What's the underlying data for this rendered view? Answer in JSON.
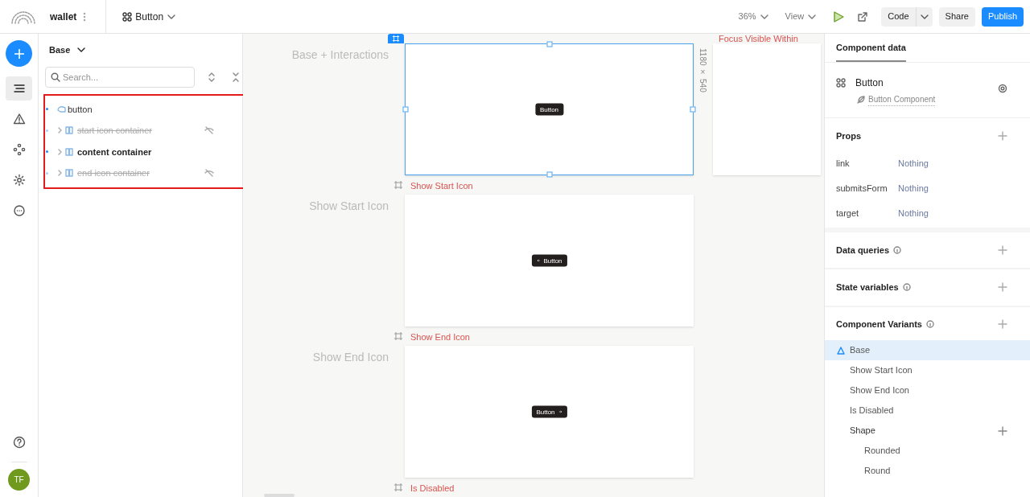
{
  "topbar": {
    "project": "wallet",
    "component": "Button",
    "zoom": "36%",
    "view": "View",
    "code": "Code",
    "share": "Share",
    "publish": "Publish"
  },
  "rail": {
    "items": [
      {
        "kind": "outline",
        "selected": true
      },
      {
        "kind": "warning",
        "selected": false
      },
      {
        "kind": "components",
        "selected": false
      },
      {
        "kind": "settings",
        "selected": false
      },
      {
        "kind": "more",
        "selected": false
      }
    ],
    "avatar": "TF"
  },
  "left_panel": {
    "variant": "Base",
    "search": {
      "placeholder": "Search..."
    },
    "tree": [
      {
        "label": "button",
        "kind": "component",
        "hidden": false,
        "children": [
          {
            "label": "start icon container",
            "kind": "container",
            "hidden": true
          },
          {
            "label": "content container",
            "kind": "container",
            "hidden": false
          },
          {
            "label": "end icon container",
            "kind": "container",
            "hidden": true
          }
        ]
      }
    ]
  },
  "canvas": {
    "rows": [
      {
        "label": "Base + Interactions",
        "frame_title": "",
        "selected": true,
        "button": "Button",
        "kind": "plain"
      },
      {
        "label": "Show Start Icon",
        "frame_title": "Show Start Icon",
        "selected": false,
        "button": "Button",
        "kind": "start_icon"
      },
      {
        "label": "Show End Icon",
        "frame_title": "Show End Icon",
        "selected": false,
        "button": "Button",
        "kind": "end_icon"
      }
    ],
    "next_frame_title": "Is Disabled",
    "side_frame_title": "Focus Visible Within",
    "dimensions": "1180 × 540"
  },
  "right_panel": {
    "tab": "Component data",
    "component": {
      "name": "Button",
      "description": "Button Component"
    },
    "props": {
      "title": "Props",
      "items": [
        {
          "name": "link",
          "value": "Nothing"
        },
        {
          "name": "submitsForm",
          "value": "Nothing"
        },
        {
          "name": "target",
          "value": "Nothing"
        }
      ]
    },
    "sections": [
      {
        "title": "Data queries"
      },
      {
        "title": "State variables"
      },
      {
        "title": "Component Variants"
      }
    ],
    "variants": [
      {
        "label": "Base",
        "kind": "base",
        "selected": true
      },
      {
        "label": "Show Start Icon",
        "kind": "variant",
        "selected": false
      },
      {
        "label": "Show End Icon",
        "kind": "variant",
        "selected": false
      },
      {
        "label": "Is Disabled",
        "kind": "variant",
        "selected": false
      },
      {
        "label": "Shape",
        "kind": "group",
        "selected": false,
        "children": [
          {
            "label": "Rounded",
            "selected": false
          },
          {
            "label": "Round",
            "selected": false
          }
        ]
      }
    ]
  }
}
